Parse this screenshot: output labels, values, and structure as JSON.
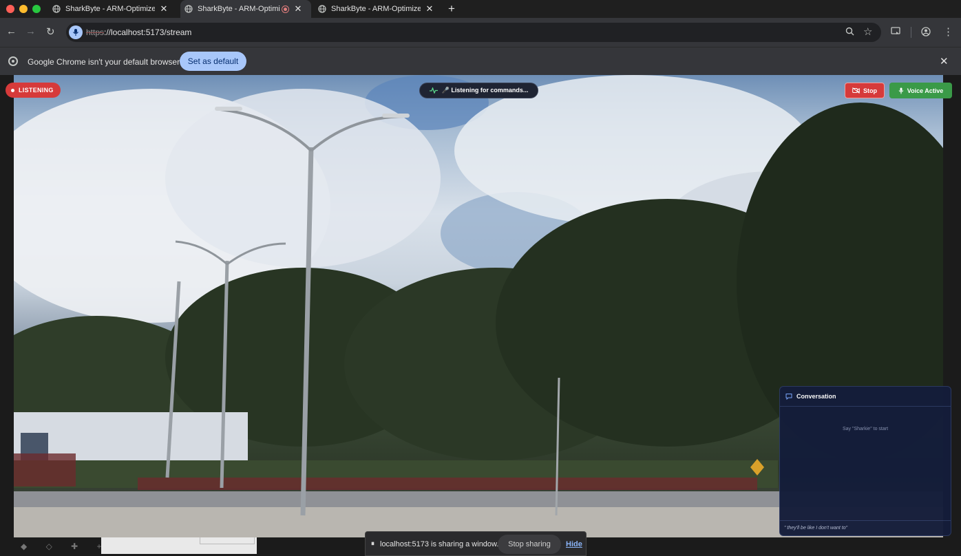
{
  "tabs": [
    {
      "title": "SharkByte - ARM-Optimized",
      "close": "✕"
    },
    {
      "title": "SharkByte - ARM-Optimiz",
      "close": "✕"
    },
    {
      "title": "SharkByte - ARM-Optimized",
      "close": "✕"
    }
  ],
  "new_tab": "+",
  "toolbar": {
    "url_scheme": "https",
    "url_rest": "://localhost:5173/stream"
  },
  "infobar": {
    "message": "Google Chrome isn't your default browser",
    "set_default_label": "Set as default",
    "close": "✕"
  },
  "stream": {
    "listening_badge": "LISTENING",
    "status_pill": "🎤 Listening for commands...",
    "stop_label": "Stop",
    "voice_label": "Voice Active"
  },
  "conversation": {
    "title": "Conversation",
    "empty_hint": "Say \"Sharkie\" to start",
    "transcript": "\" they'll be like I don't want to\""
  },
  "share_bar": {
    "pause_glyph": "⏸",
    "message": "localhost:5173 is sharing a window.",
    "stop_label": "Stop sharing",
    "hide_label": "Hide"
  },
  "colors": {
    "listening_red": "#d63a3a",
    "voice_green": "#3a9a48",
    "chip_blue": "#a8c7fa",
    "panel_navy": "#141d3a"
  }
}
